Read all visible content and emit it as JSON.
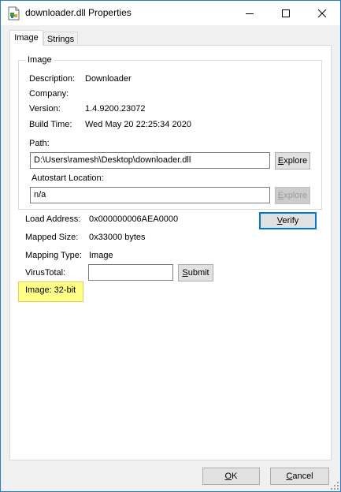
{
  "window": {
    "title": "downloader.dll Properties",
    "tabs": [
      "Image",
      "Strings"
    ]
  },
  "group": {
    "legend": "Image",
    "fields": [
      {
        "label": "Description:",
        "value": "Downloader"
      },
      {
        "label": "Company:",
        "value": ""
      },
      {
        "label": "Version:",
        "value": "1.4.9200.23072"
      },
      {
        "label": "Build Time:",
        "value": "Wed May 20 22:25:34 2020"
      }
    ],
    "path_label": "Path:",
    "path_value": "D:\\Users\\ramesh\\Desktop\\downloader.dll",
    "path_button_prefix": "",
    "path_button_accel": "E",
    "path_button_rest": "xplore",
    "autostart_label": "Autostart Location:",
    "autostart_value": "n/a",
    "autostart_button_prefix": "",
    "autostart_button_accel": "E",
    "autostart_button_rest": "xplore"
  },
  "details": {
    "load_address_label": "Load Address:",
    "load_address_value": "0x000000006AEA0000",
    "mapped_size_label": "Mapped Size:",
    "mapped_size_value": "0x33000 bytes",
    "mapping_type_label": "Mapping Type:",
    "mapping_type_value": "Image",
    "virustotal_label": "VirusTotal:",
    "virustotal_value": "",
    "verify_button_prefix": "",
    "verify_button_accel": "V",
    "verify_button_rest": "erify",
    "submit_button_prefix": "",
    "submit_button_accel": "S",
    "submit_button_rest": "ubmit",
    "image_bitness": "Image: 32-bit"
  },
  "footer": {
    "ok_prefix": "",
    "ok_accel": "O",
    "ok_rest": "K",
    "cancel_prefix": "",
    "cancel_accel": "C",
    "cancel_rest": "ancel"
  },
  "colors": {
    "accent": "#0078d7",
    "highlight": "#ffff88",
    "window_border": "#2b79d8"
  },
  "icons": [
    "dll-file-icon",
    "minimize-icon",
    "maximize-icon",
    "close-icon"
  ]
}
